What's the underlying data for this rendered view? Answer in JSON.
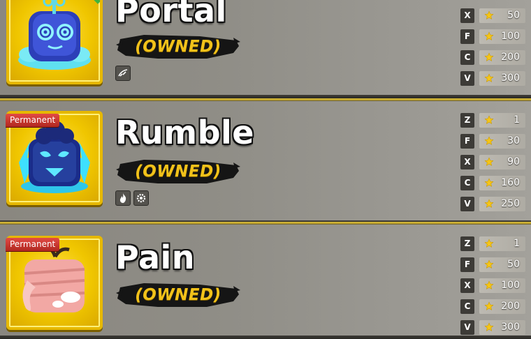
{
  "fruits": [
    {
      "name": "Portal",
      "status": "(OWNED)",
      "badge": "",
      "abilities": [
        "wind-swirl-icon"
      ],
      "moves": [
        {
          "key": "X",
          "mastery": "50"
        },
        {
          "key": "F",
          "mastery": "100"
        },
        {
          "key": "C",
          "mastery": "200"
        },
        {
          "key": "V",
          "mastery": "300"
        }
      ]
    },
    {
      "name": "Rumble",
      "status": "(OWNED)",
      "badge": "Permanent",
      "abilities": [
        "flame-icon",
        "gear-icon"
      ],
      "moves": [
        {
          "key": "Z",
          "mastery": "1"
        },
        {
          "key": "F",
          "mastery": "30"
        },
        {
          "key": "X",
          "mastery": "90"
        },
        {
          "key": "C",
          "mastery": "160"
        },
        {
          "key": "V",
          "mastery": "250"
        }
      ]
    },
    {
      "name": "Pain",
      "status": "(OWNED)",
      "badge": "Permanent",
      "abilities": [],
      "moves": [
        {
          "key": "Z",
          "mastery": "1"
        },
        {
          "key": "F",
          "mastery": "50"
        },
        {
          "key": "X",
          "mastery": "100"
        },
        {
          "key": "C",
          "mastery": "200"
        },
        {
          "key": "V",
          "mastery": "300"
        }
      ]
    }
  ],
  "colors": {
    "frame_gold": "#e6b800",
    "owned_gold": "#f2c21a",
    "badge_red": "#c8332c",
    "key_bg": "#3d3b37",
    "star": "#f5c518"
  }
}
